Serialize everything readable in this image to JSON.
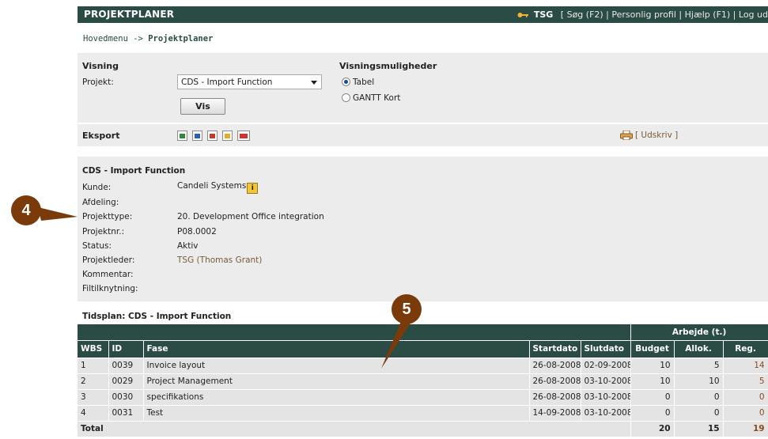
{
  "header": {
    "app_title": "PROJEKTPLANER",
    "user": "TSG",
    "links_text": "[ Søg (F2) | Personlig profil | Hjælp (F1) | Log ud"
  },
  "breadcrumb": {
    "home": "Hovedmenu",
    "sep": "->",
    "current": "Projektplaner"
  },
  "visning": {
    "title": "Visning",
    "project_label": "Projekt:",
    "project_value": "CDS - Import Function",
    "show_button": "Vis"
  },
  "view_options": {
    "title": "Visningsmuligheder",
    "options": [
      {
        "label": "Tabel",
        "checked": true
      },
      {
        "label": "GANTT Kort",
        "checked": false
      }
    ]
  },
  "eksport": {
    "title": "Eksport",
    "print_label": "[ Udskriv ]",
    "icons": [
      "excel-icon",
      "word-icon",
      "pdf-icon",
      "outlook-icon",
      "xml-icon"
    ]
  },
  "project_info": {
    "title": "CDS - Import Function",
    "rows": [
      {
        "label": "Kunde:",
        "value": "Candeli Systems"
      },
      {
        "label": "Afdeling:",
        "value": ""
      },
      {
        "label": "Projekttype:",
        "value": "20. Development Office integration"
      },
      {
        "label": "Projektnr.:",
        "value": "P08.0002"
      },
      {
        "label": "Status:",
        "value": "Aktiv"
      },
      {
        "label": "Projektleder:",
        "value": "TSG (Thomas Grant)"
      },
      {
        "label": "Kommentar:",
        "value": ""
      },
      {
        "label": "Filtilknytning:",
        "value": ""
      }
    ],
    "info_glyph": "i"
  },
  "schedule": {
    "title": "Tidsplan: CDS - Import Function",
    "group_header": "Arbejde (t.)",
    "columns": [
      "WBS",
      "ID",
      "Fase",
      "Startdato",
      "Slutdato",
      "Budget",
      "Allok.",
      "Reg."
    ],
    "rows": [
      {
        "wbs": "1",
        "id": "0039",
        "fase": "Invoice layout",
        "start": "26-08-2008",
        "end": "02-09-2008",
        "budget": "10",
        "allok": "5",
        "reg": "14"
      },
      {
        "wbs": "2",
        "id": "0029",
        "fase": "Project Management",
        "start": "26-08-2008",
        "end": "03-10-2008",
        "budget": "10",
        "allok": "10",
        "reg": "5"
      },
      {
        "wbs": "3",
        "id": "0030",
        "fase": "specifikations",
        "start": "26-08-2008",
        "end": "03-10-2008",
        "budget": "0",
        "allok": "0",
        "reg": "0"
      },
      {
        "wbs": "4",
        "id": "0031",
        "fase": "Test",
        "start": "14-09-2008",
        "end": "03-10-2008",
        "budget": "0",
        "allok": "0",
        "reg": "0"
      }
    ],
    "total": {
      "label": "Total",
      "budget": "20",
      "allok": "15",
      "reg": "19"
    }
  },
  "callouts": {
    "a": "4",
    "b": "5"
  },
  "colors": {
    "header_bg": "#2a4c45",
    "panel_bg": "#ececec",
    "callout": "#7a3a0a",
    "link_brown": "#7a5a36"
  }
}
